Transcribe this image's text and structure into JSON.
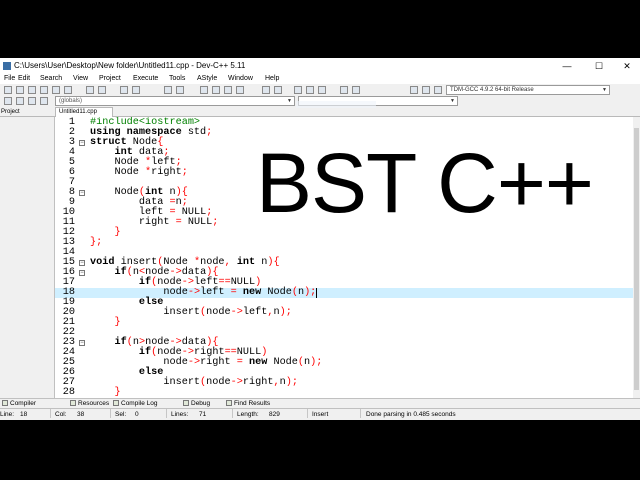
{
  "window": {
    "title": "C:\\Users\\User\\Desktop\\New folder\\Untitled11.cpp - Dev-C++ 5.11",
    "minimize": "—",
    "maximize": "☐",
    "close": "✕"
  },
  "menu": [
    "File",
    "Edit",
    "Search",
    "View",
    "Project",
    "Execute",
    "Tools",
    "AStyle",
    "Window",
    "Help"
  ],
  "toolbar": {
    "compiler": "TDM-GCC 4.9.2 64-bit Release",
    "scope_globals": "(globals)"
  },
  "panels": {
    "project_tab": "Project",
    "file_tab": "Untitled11.cpp"
  },
  "editor": {
    "current_line": 18,
    "lines": [
      {
        "n": "1",
        "fold": "",
        "html": "<span class=\"prep\">#include&lt;iostream&gt;</span>"
      },
      {
        "n": "2",
        "fold": "",
        "html": "<span class=\"kw\">using namespace</span> std<span class=\"sym\">;</span>"
      },
      {
        "n": "3",
        "fold": "−",
        "html": "<span class=\"kw\">struct</span> Node<span class=\"sym\">{</span>"
      },
      {
        "n": "4",
        "fold": "",
        "html": "    <span class=\"kw\">int</span> data<span class=\"sym\">;</span>"
      },
      {
        "n": "5",
        "fold": "",
        "html": "    Node <span class=\"sym\">*</span>left<span class=\"sym\">;</span>"
      },
      {
        "n": "6",
        "fold": "",
        "html": "    Node <span class=\"sym\">*</span>right<span class=\"sym\">;</span>"
      },
      {
        "n": "7",
        "fold": "",
        "html": ""
      },
      {
        "n": "8",
        "fold": "−",
        "html": "    Node<span class=\"sym\">(</span><span class=\"kw\">int</span> n<span class=\"sym\">){</span>"
      },
      {
        "n": "9",
        "fold": "",
        "html": "        data <span class=\"sym\">=</span>n<span class=\"sym\">;</span>"
      },
      {
        "n": "10",
        "fold": "",
        "html": "        left <span class=\"sym\">=</span> NULL<span class=\"sym\">;</span>"
      },
      {
        "n": "11",
        "fold": "",
        "html": "        right <span class=\"sym\">=</span> NULL<span class=\"sym\">;</span>"
      },
      {
        "n": "12",
        "fold": "",
        "html": "    <span class=\"sym\">}</span>"
      },
      {
        "n": "13",
        "fold": "",
        "html": "<span class=\"sym\">};</span>"
      },
      {
        "n": "14",
        "fold": "",
        "html": ""
      },
      {
        "n": "15",
        "fold": "−",
        "html": "<span class=\"kw\">void</span> insert<span class=\"sym\">(</span>Node <span class=\"sym\">*</span>node<span class=\"sym\">,</span> <span class=\"kw\">int</span> n<span class=\"sym\">){</span>"
      },
      {
        "n": "16",
        "fold": "−",
        "html": "    <span class=\"kw\">if</span><span class=\"sym\">(</span>n<span class=\"sym\">&lt;</span>node<span class=\"sym\">-&gt;</span>data<span class=\"sym\">){</span>"
      },
      {
        "n": "17",
        "fold": "",
        "html": "        <span class=\"kw\">if</span><span class=\"sym\">(</span>node<span class=\"sym\">-&gt;</span>left<span class=\"sym\">==</span>NULL<span class=\"sym\">)</span>"
      },
      {
        "n": "18",
        "fold": "",
        "html": "            node<span class=\"sym\">-&gt;</span>left <span class=\"sym\">=</span> <span class=\"kw\">new</span> Node<span class=\"sym\">(</span>n<span class=\"sym\">);</span><span class=\"caret\"></span>"
      },
      {
        "n": "19",
        "fold": "",
        "html": "        <span class=\"kw\">else</span>"
      },
      {
        "n": "20",
        "fold": "",
        "html": "            insert<span class=\"sym\">(</span>node<span class=\"sym\">-&gt;</span>left<span class=\"sym\">,</span>n<span class=\"sym\">);</span>"
      },
      {
        "n": "21",
        "fold": "",
        "html": "    <span class=\"sym\">}</span>"
      },
      {
        "n": "22",
        "fold": "",
        "html": ""
      },
      {
        "n": "23",
        "fold": "−",
        "html": "    <span class=\"kw\">if</span><span class=\"sym\">(</span>n<span class=\"sym\">&gt;</span>node<span class=\"sym\">-&gt;</span>data<span class=\"sym\">){</span>"
      },
      {
        "n": "24",
        "fold": "",
        "html": "        <span class=\"kw\">if</span><span class=\"sym\">(</span>node<span class=\"sym\">-&gt;</span>right<span class=\"sym\">==</span>NULL<span class=\"sym\">)</span>"
      },
      {
        "n": "25",
        "fold": "",
        "html": "            node<span class=\"sym\">-&gt;</span>right <span class=\"sym\">=</span> <span class=\"kw\">new</span> Node<span class=\"sym\">(</span>n<span class=\"sym\">);</span>"
      },
      {
        "n": "26",
        "fold": "",
        "html": "        <span class=\"kw\">else</span>"
      },
      {
        "n": "27",
        "fold": "",
        "html": "            insert<span class=\"sym\">(</span>node<span class=\"sym\">-&gt;</span>right<span class=\"sym\">,</span>n<span class=\"sym\">);</span>"
      },
      {
        "n": "28",
        "fold": "",
        "html": "    <span class=\"sym\">}</span>"
      }
    ]
  },
  "overlay": {
    "title": "BST C++"
  },
  "bottom_tabs": [
    "Compiler",
    "Resources",
    "Compile Log",
    "Debug",
    "Find Results"
  ],
  "status": {
    "line_label": "Line:",
    "line_value": "18",
    "col_label": "Col:",
    "col_value": "38",
    "sel_label": "Sel:",
    "sel_value": "0",
    "lines_label": "Lines:",
    "lines_value": "71",
    "length_label": "Length:",
    "length_value": "829",
    "mode": "Insert",
    "message": "Done parsing in 0.485 seconds"
  },
  "colors": {
    "keyword": "#000000",
    "symbol": "#ff0000",
    "preprocessor": "#008000",
    "current_line": "#cfefff"
  }
}
